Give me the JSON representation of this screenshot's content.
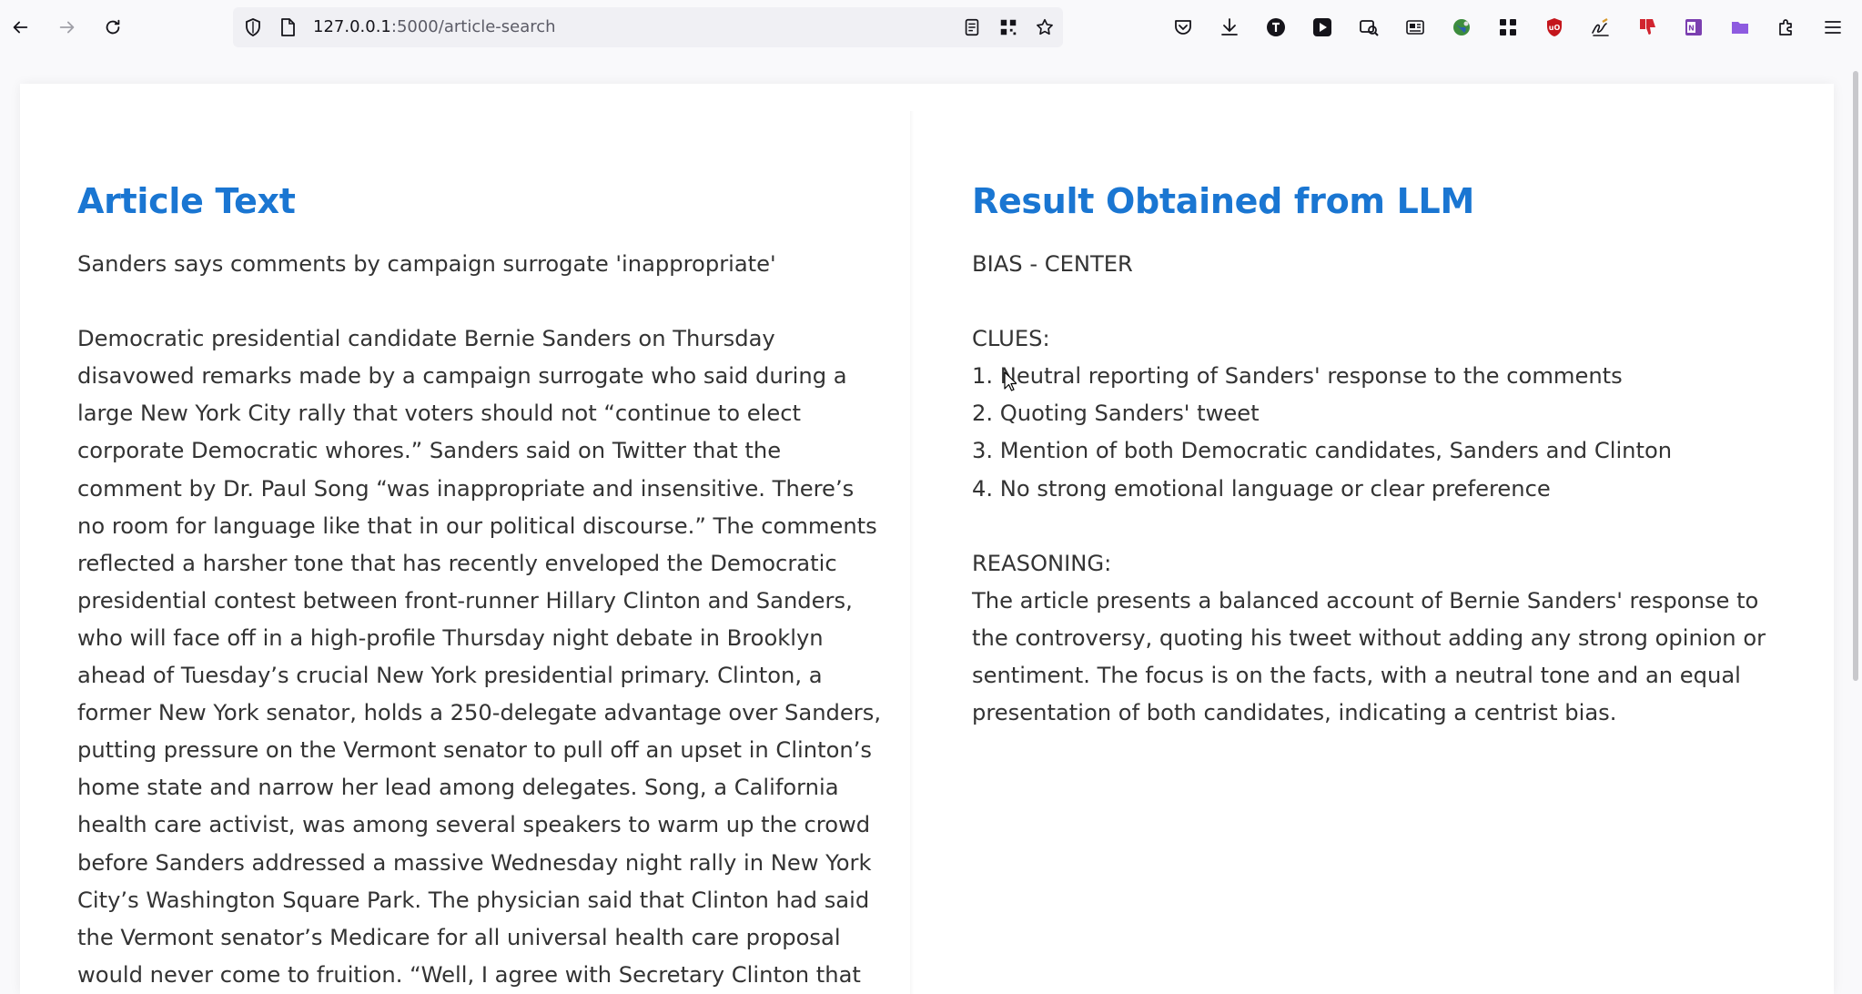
{
  "browser": {
    "url_host": "127.0.0.1",
    "url_path": ":5000/article-search",
    "icons": {
      "back": "back-arrow-icon",
      "forward": "forward-arrow-icon",
      "reload": "reload-icon",
      "shield": "tracking-shield-icon",
      "page": "page-icon",
      "reader": "reader-view-icon",
      "qr": "qr-code-icon",
      "bookmark": "star-icon",
      "pocket": "pocket-icon",
      "download": "download-icon",
      "menu": "hamburger-menu-icon"
    }
  },
  "left_panel": {
    "heading": "Article Text",
    "article_text": "Sanders says comments by campaign surrogate 'inappropriate'\n\nDemocratic presidential candidate Bernie Sanders on Thursday disavowed remarks made by a campaign surrogate who said during a large New York City rally that voters should not “continue to elect corporate Democratic whores.” Sanders said on Twitter that the comment by Dr. Paul Song “was inappropriate and insensitive. There’s no room for language like that in our political discourse.” The comments reflected a harsher tone that has recently enveloped the Democratic presidential contest between front-runner Hillary Clinton and Sanders, who will face off in a high-profile Thursday night debate in Brooklyn ahead of Tuesday’s crucial New York presidential primary. Clinton, a former New York senator, holds a 250-delegate advantage over Sanders, putting pressure on the Vermont senator to pull off an upset in Clinton’s home state and narrow her lead among delegates. Song, a California health care activist, was among several speakers to warm up the crowd before Sanders addressed a massive Wednesday night rally in New York City’s Washington Square Park. The physician said that Clinton had said the Vermont senator’s Medicare for all universal health care proposal would never come to fruition. “Well, I agree with Secretary Clinton that Medicare for all will never happen if we have a president who never aspires for something greater"
  },
  "right_panel": {
    "heading": "Result Obtained from LLM",
    "result_text": "BIAS - CENTER\n\nCLUES:\n1. Neutral reporting of Sanders' response to the comments\n2. Quoting Sanders' tweet\n3. Mention of both Democratic candidates, Sanders and Clinton\n4. No strong emotional language or clear preference\n\nREASONING:\nThe article presents a balanced account of Bernie Sanders' response to the controversy, quoting his tweet without adding any strong opinion or sentiment. The focus is on the facts, with a neutral tone and an equal presentation of both candidates, indicating a centrist bias."
  },
  "colors": {
    "heading": "#1a76d2",
    "body_text": "#333333",
    "background": "#f9f9fb",
    "card": "#ffffff"
  }
}
